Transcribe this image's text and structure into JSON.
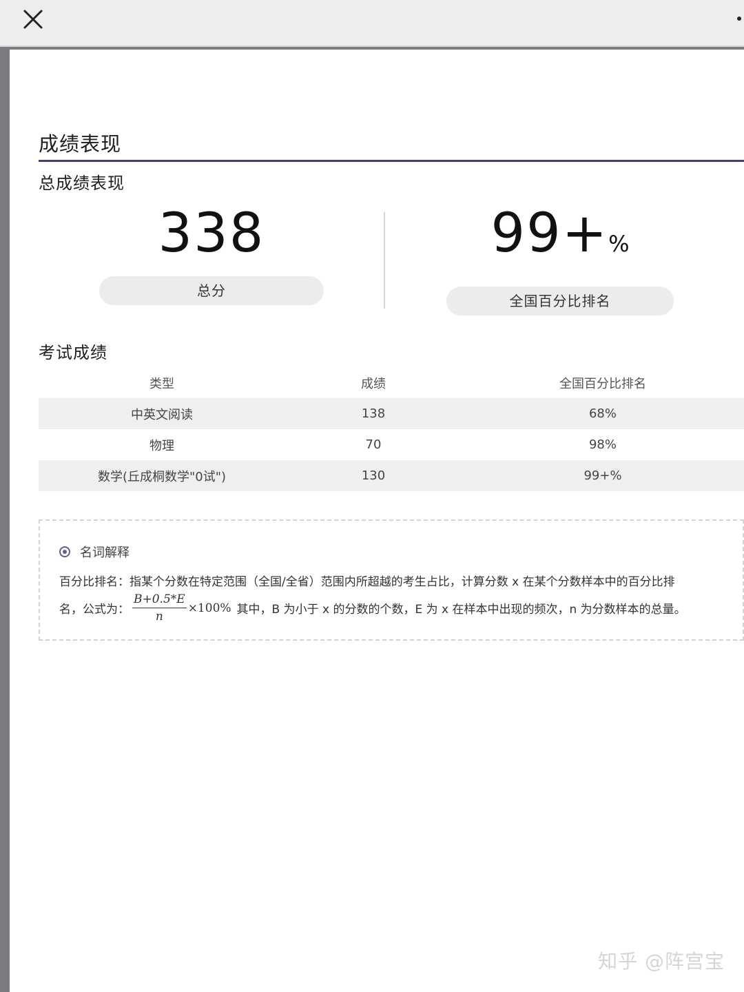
{
  "page": {
    "section_title": "成绩表现",
    "subtitle": "总成绩表现",
    "accent_color": "#4b3a6e"
  },
  "summary": {
    "total_score": "338",
    "total_label": "总分",
    "rank_value": "99+",
    "rank_unit": "%",
    "rank_label": "全国百分比排名"
  },
  "exam": {
    "title": "考试成绩",
    "columns": [
      "类型",
      "成绩",
      "全国百分比排名"
    ],
    "rows": [
      [
        "中英文阅读",
        "138",
        "68%"
      ],
      [
        "物理",
        "70",
        "98%"
      ],
      [
        "数学(丘成桐数学\"0试\")",
        "130",
        "99+%"
      ]
    ]
  },
  "glossary": {
    "heading": "名词解释",
    "line1": "百分比排名：指某个分数在特定范围（全国/全省）范围内所超越的考生占比，计算分数 x 在某个分数样本中的百分比排",
    "line2_prefix": "名，公式为：",
    "formula_numerator": "B+0.5*E",
    "formula_denominator": "n",
    "formula_suffix": "×100%",
    "line2_rest": "其中，B 为小于 x 的分数的个数，E 为 x 在样本中出现的频次，n 为分数样本的总量。"
  },
  "watermark": "知乎 @阵宫宝",
  "icons": {
    "close": "close-icon",
    "glossary": "radio-icon"
  }
}
